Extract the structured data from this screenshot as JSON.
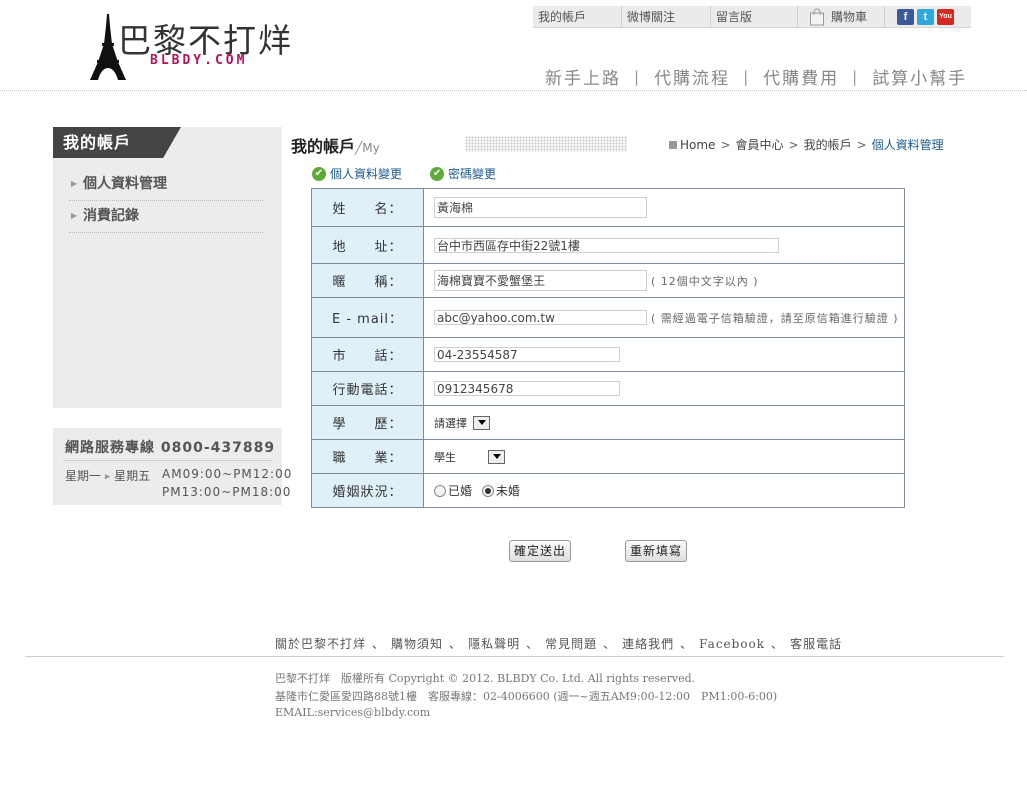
{
  "brand": {
    "name": "巴黎不打烊",
    "sub": "BLBDY.COM"
  },
  "topbar": {
    "links": [
      "我的帳戶",
      "微博關注",
      "留言版"
    ],
    "cart_label": "購物車",
    "social": [
      "facebook-icon",
      "twitter-icon",
      "youtube-icon"
    ]
  },
  "nav": {
    "items": [
      "新手上路",
      "代購流程",
      "代購費用",
      "試算小幫手"
    ],
    "separator": "|"
  },
  "sidebar": {
    "title": "我的帳戶",
    "items": [
      {
        "label": "個人資料管理"
      },
      {
        "label": "消費記錄"
      }
    ],
    "service": {
      "title": "網路服務專線 0800-437889",
      "days_from": "星期一",
      "days_to": "星期五",
      "time1": "AM09:00~PM12:00",
      "time2": "PM13:00~PM18:00"
    }
  },
  "page": {
    "title": "我的帳戶",
    "title_en": "╱My",
    "breadcrumb": [
      "Home",
      "會員中心",
      "我的帳戶",
      "個人資料管理"
    ],
    "breadcrumb_sep": ">",
    "tabs": [
      "個人資料變更",
      "密碼變更"
    ]
  },
  "form": {
    "name": {
      "label": "姓　　名：",
      "value": "黃海棉"
    },
    "address": {
      "label": "地　　址：",
      "value": "台中市西區存中街22號1樓"
    },
    "nickname": {
      "label": "暱　　稱：",
      "value": "海棉寶寶不愛蟹堡王",
      "note": "( 12個中文字以內 )"
    },
    "email": {
      "label": "E - mail：",
      "value": "abc@yahoo.com.tw",
      "note": "( 需經過電子信箱驗證，請至原信箱進行驗證 )"
    },
    "phone": {
      "label": "市　　話：",
      "value": "04-23554587"
    },
    "mobile": {
      "label": "行動電話：",
      "value": "0912345678"
    },
    "education": {
      "label": "學　　歷：",
      "value": "請選擇"
    },
    "job": {
      "label": "職　　業：",
      "value": "學生"
    },
    "marital": {
      "label": "婚姻狀況：",
      "options": [
        "已婚",
        "未婚"
      ],
      "selected": "未婚"
    },
    "submit_label": "確定送出",
    "reset_label": "重新填寫"
  },
  "footer": {
    "links": [
      "關於巴黎不打烊",
      "購物須知",
      "隱私聲明",
      "常見問題",
      "連絡我們",
      "Facebook",
      "客服電話"
    ],
    "link_sep": "、",
    "line1": "巴黎不打烊　版權所有 Copyright © 2012. BLBDY  Co. Ltd. All rights reserved.",
    "line2": "基隆市仁愛區愛四路88號1樓　客服專線：02-4006600 (週一~週五AM9:00-12:00　PM1:00-6:00)",
    "line3": "EMAIL:services@blbdy.com"
  },
  "colors": {
    "accent_magenta": "#b3125e",
    "link_blue": "#1e5a8c",
    "label_bg": "#dff0f8",
    "check_green": "#5eaa3a"
  }
}
